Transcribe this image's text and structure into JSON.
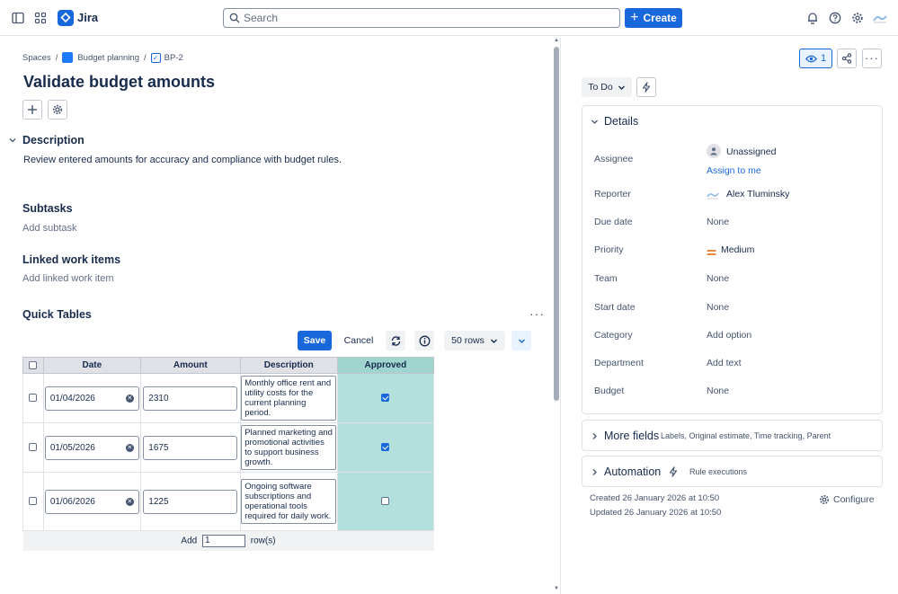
{
  "topbar": {
    "app_name": "Jira",
    "search_placeholder": "Search",
    "create_label": "Create"
  },
  "breadcrumb": {
    "spaces": "Spaces",
    "project": "Budget planning",
    "issue_key": "BP-2"
  },
  "issue": {
    "title": "Validate budget amounts"
  },
  "description": {
    "heading": "Description",
    "text": "Review entered amounts for accuracy and compliance with budget rules."
  },
  "subtasks": {
    "heading": "Subtasks",
    "add_label": "Add subtask"
  },
  "linked": {
    "heading": "Linked work items",
    "add_label": "Add linked work item"
  },
  "quick_tables": {
    "heading": "Quick Tables",
    "save_label": "Save",
    "cancel_label": "Cancel",
    "rows_label": "50 rows",
    "columns": [
      "Date",
      "Amount",
      "Description",
      "Approved"
    ],
    "rows": [
      {
        "date": "01/04/2026",
        "amount": "2310",
        "description": "Monthly office rent and utility costs for the current planning period.",
        "approved": true
      },
      {
        "date": "01/05/2026",
        "amount": "1675",
        "description": "Planned marketing and promotional activities to support business growth.",
        "approved": true
      },
      {
        "date": "01/06/2026",
        "amount": "1225",
        "description": "Ongoing software subscriptions and operational tools required for daily work.",
        "approved": false
      }
    ],
    "footer": {
      "add_label": "Add",
      "add_value": "1",
      "rows_suffix": "row(s)"
    }
  },
  "right": {
    "watch_count": "1",
    "status": "To Do",
    "details_heading": "Details",
    "fields": {
      "assignee_label": "Assignee",
      "assignee_value": "Unassigned",
      "assign_to_me": "Assign to me",
      "reporter_label": "Reporter",
      "reporter_value": "Alex Tluminsky",
      "due_label": "Due date",
      "due_value": "None",
      "priority_label": "Priority",
      "priority_value": "Medium",
      "team_label": "Team",
      "team_value": "None",
      "start_label": "Start date",
      "start_value": "None",
      "category_label": "Category",
      "category_value": "Add option",
      "department_label": "Department",
      "department_value": "Add text",
      "budget_label": "Budget",
      "budget_value": "None"
    },
    "more_fields": {
      "heading": "More fields",
      "hint": "Labels, Original estimate, Time tracking, Parent"
    },
    "automation": {
      "heading": "Automation",
      "hint": "Rule executions"
    },
    "created": "Created 26 January 2026 at 10:50",
    "updated": "Updated 26 January 2026 at 10:50",
    "configure_label": "Configure"
  },
  "colors": {
    "brand": "#1868db",
    "approved_column": "#b3e0dc",
    "priority_medium": "#e56910"
  }
}
